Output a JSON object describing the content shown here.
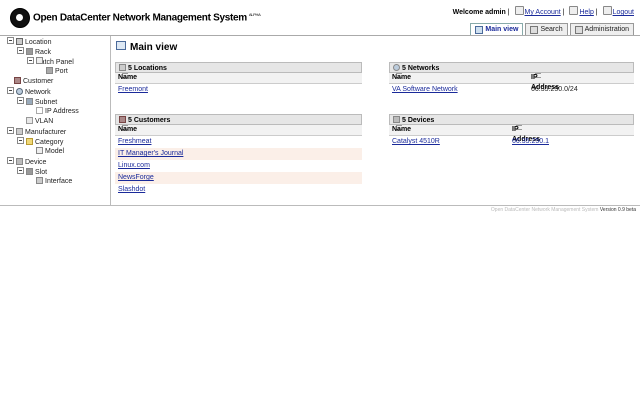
{
  "app": {
    "title": "Open DataCenter Network Management System",
    "sup": "ALPHA"
  },
  "userbar": {
    "welcome": "Welcome admin",
    "sep1": "|",
    "account": "My Account",
    "sep2": "|",
    "help": "Help",
    "sep3": "|",
    "logout": "Logout"
  },
  "tabs": [
    {
      "label": "Main view",
      "active": true
    },
    {
      "label": "Search",
      "active": false
    },
    {
      "label": "Administration",
      "active": false
    }
  ],
  "tree": [
    {
      "label": "Location",
      "icon": "location-icon"
    },
    {
      "label": "Rack",
      "icon": "rack-icon"
    },
    {
      "label": "Patch Panel",
      "icon": "patch-panel-icon"
    },
    {
      "label": "Port",
      "icon": "port-icon"
    },
    {
      "label": "Customer",
      "icon": "customer-icon"
    },
    {
      "label": "Network",
      "icon": "network-icon"
    },
    {
      "label": "Subnet",
      "icon": "subnet-icon"
    },
    {
      "label": "IP Address",
      "icon": "ip-address-icon"
    },
    {
      "label": "VLAN",
      "icon": "vlan-icon"
    },
    {
      "label": "Manufacturer",
      "icon": "manufacturer-icon"
    },
    {
      "label": "Category",
      "icon": "category-icon"
    },
    {
      "label": "Model",
      "icon": "model-icon"
    },
    {
      "label": "Device",
      "icon": "device-icon"
    },
    {
      "label": "Slot",
      "icon": "slot-icon"
    },
    {
      "label": "Interface",
      "icon": "interface-icon"
    }
  ],
  "main": {
    "title": "Main view",
    "locations": {
      "title": "5 Locations",
      "col_name": "Name",
      "rows": [
        "Freemont"
      ]
    },
    "networks": {
      "title": "5 Networks",
      "col_name": "Name",
      "col_ip": "IP Address",
      "rows": [
        {
          "name": "VA Software Network",
          "ip": "66.35.250.0/24"
        }
      ]
    },
    "customers": {
      "title": "5 Customers",
      "col_name": "Name",
      "rows": [
        "Freshmeat",
        "IT Manager's Journal",
        "Linux.com",
        "NewsForge",
        "Slashdot"
      ]
    },
    "devices": {
      "title": "5 Devices",
      "col_name": "Name",
      "col_ip": "IP Address",
      "rows": [
        {
          "name": "Catalyst 4510R",
          "ip": "66.35.250.1"
        }
      ]
    }
  },
  "footer": {
    "text": "Open DataCenter Network Management System",
    "version": "Version 0.9 beta"
  }
}
